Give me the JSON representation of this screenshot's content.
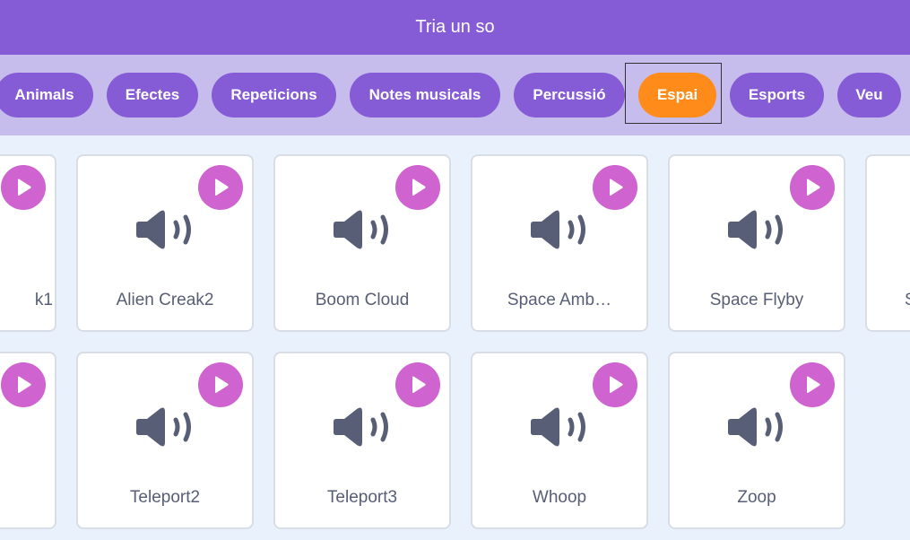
{
  "header": {
    "title": "Tria un so"
  },
  "filters": {
    "items": [
      {
        "label": "Animals"
      },
      {
        "label": "Efectes"
      },
      {
        "label": "Repeticions"
      },
      {
        "label": "Notes musicals"
      },
      {
        "label": "Percussió"
      },
      {
        "label": "Espai",
        "selected": true
      },
      {
        "label": "Esports"
      },
      {
        "label": "Veu"
      }
    ]
  },
  "sounds": {
    "row1": [
      {
        "label": "k1"
      },
      {
        "label": "Alien Creak2"
      },
      {
        "label": "Boom Cloud"
      },
      {
        "label": "Space Amb…"
      },
      {
        "label": "Space Flyby"
      },
      {
        "label": "S"
      }
    ],
    "row2": [
      {
        "label": ""
      },
      {
        "label": "Teleport2"
      },
      {
        "label": "Teleport3"
      },
      {
        "label": "Whoop"
      },
      {
        "label": "Zoop"
      }
    ]
  },
  "icons": {
    "play": "play-icon",
    "speaker": "speaker-icon"
  },
  "colors": {
    "header_bg": "#855cd6",
    "filter_bar_bg": "#c6bdec",
    "pill_bg": "#855cd6",
    "pill_active_bg": "#ff8c1a",
    "play_button_bg": "#cf63cf",
    "speaker_icon": "#575e75",
    "grid_bg": "#e9f1fc"
  }
}
